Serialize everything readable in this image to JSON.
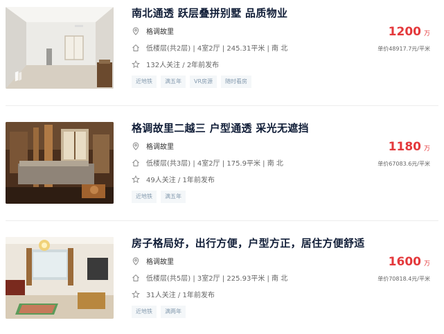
{
  "listings": [
    {
      "title": "南北通透 跃层叠拼别墅 品质物业",
      "community": "格调故里",
      "house_info": "低楼层(共2层) | 4室2厅 | 245.31平米 | 南 北",
      "follow_info": "132人关注 / 2年前发布",
      "tags": [
        "近地铁",
        "满五年",
        "VR房源",
        "随时看房"
      ],
      "total_price": "1200",
      "total_unit": "万",
      "unit_price": "单价48917.7元/平米"
    },
    {
      "title": "格调故里二越三 户型通透 采光无遮挡",
      "community": "格调故里",
      "house_info": "低楼层(共3层) | 4室2厅 | 175.9平米 | 南 北",
      "follow_info": "49人关注 / 1年前发布",
      "tags": [
        "近地铁",
        "满五年"
      ],
      "total_price": "1180",
      "total_unit": "万",
      "unit_price": "单价67083.6元/平米"
    },
    {
      "title": "房子格局好，出行方便，户型方正，居住方便舒适",
      "community": "格调故里",
      "house_info": "低楼层(共5层) | 3室2厅 | 225.93平米 | 南 北",
      "follow_info": "31人关注 / 1年前发布",
      "tags": [
        "近地铁",
        "满两年"
      ],
      "total_price": "1600",
      "total_unit": "万",
      "unit_price": "单价70818.4元/平米"
    }
  ],
  "icons": {
    "location": "location-pin-icon",
    "house": "house-icon",
    "follow": "star-icon"
  },
  "colors": {
    "price": "#e4393c",
    "title": "#101d37",
    "tag_bg": "#f4f7f9",
    "tag_text": "#849aae"
  }
}
